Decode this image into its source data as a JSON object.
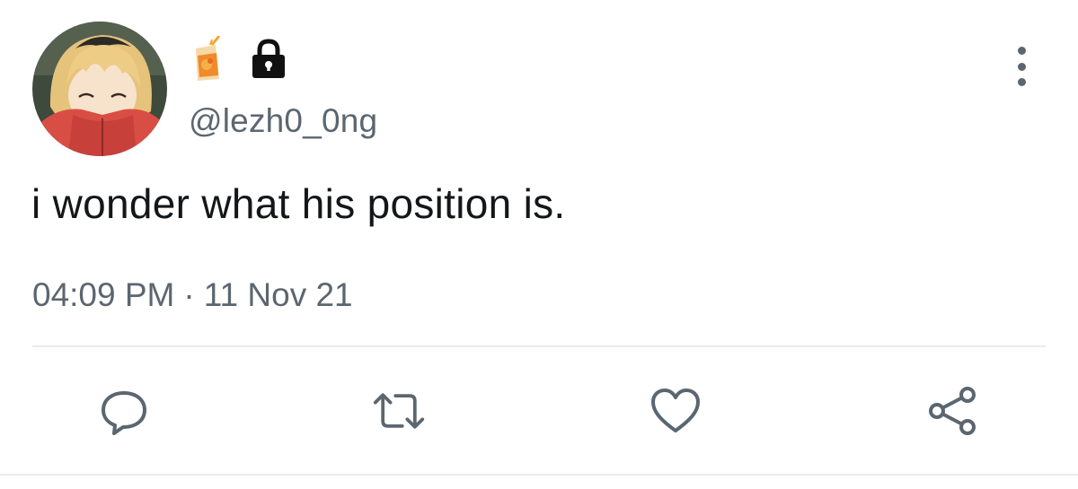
{
  "user": {
    "handle": "@lezh0_0ng",
    "avatar_icon": "avatar-anime-character",
    "emoji_icon": "juice-box-icon",
    "protected_icon": "lock-icon"
  },
  "tweet": {
    "text": "i wonder what his position is.",
    "time": "04:09 PM",
    "separator": "·",
    "date": "11 Nov 21"
  },
  "actions": [
    {
      "name": "reply",
      "icon": "reply-icon"
    },
    {
      "name": "retweet",
      "icon": "retweet-icon"
    },
    {
      "name": "like",
      "icon": "heart-icon"
    },
    {
      "name": "share",
      "icon": "share-icon"
    }
  ],
  "colors": {
    "text": "#14171a",
    "secondary": "#5b6670",
    "divider": "#e6ecf0"
  }
}
